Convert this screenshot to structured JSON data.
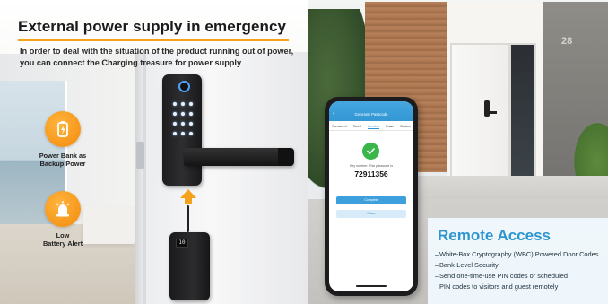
{
  "left": {
    "headline": "External power supply in emergency",
    "subtext": "In order to deal with the situation of the product running out of power, you can connect the Charging treasure for power supply",
    "badges": [
      {
        "label": "Power Bank as\nBackup Power",
        "icon": "battery-plug-icon"
      },
      {
        "label": "Low\nBattery Alert",
        "icon": "warning-light-icon"
      }
    ],
    "powerbank_display": "10",
    "accent_color": "#f5a11c"
  },
  "phone": {
    "title": "Generate Passcode",
    "back_glyph": "‹",
    "tabs": [
      "Permanent",
      "Timed",
      "One-time",
      "Erase",
      "Custom"
    ],
    "active_tab": "One-time",
    "key_label": "Key number: This passcode is",
    "code": "72911356",
    "primary_button": "Complete",
    "secondary_button": "Share"
  },
  "right": {
    "title": "Remote Access",
    "house_number": "28",
    "features": [
      {
        "dash": "–",
        "text": "White-Box Cryptography (WBC) Powered Door Codes"
      },
      {
        "dash": "–",
        "text": "Bank-Level Security"
      },
      {
        "dash": "–",
        "text": "Send one-time-use PIN codes or scheduled"
      },
      {
        "dash": "",
        "text": "PIN codes to visitors and guest remotely"
      }
    ],
    "accent_color": "#2f95cf"
  }
}
